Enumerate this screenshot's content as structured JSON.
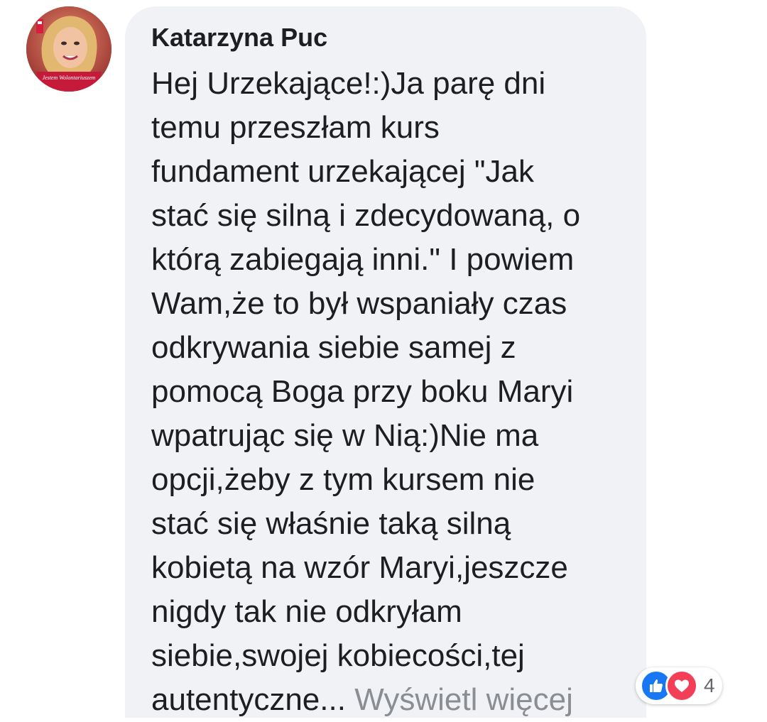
{
  "comment": {
    "author": "Katarzyna Puc",
    "body_lines": [
      "Hej Urzekające!:)Ja parę dni",
      "temu przeszłam kurs",
      "fundament urzekającej \"Jak",
      "stać się silną i zdecydowaną, o",
      "którą zabiegają inni.\" I powiem",
      "Wam,że to był wspaniały czas",
      "odkrywania siebie samej z",
      "pomocą Boga przy boku Maryi",
      "wpatrując się w Nią:)Nie ma",
      "opcji,żeby z tym kursem nie",
      "stać się właśnie taką silną",
      "kobietą na wzór Maryi,jeszcze",
      "nigdy tak nie odkryłam",
      "siebie,swojej kobiecości,tej"
    ],
    "last_line": "autentyczne...",
    "see_more_label": "Wyświetl więcej",
    "avatar_caption": "Jestem Wolontariuszem",
    "reactions": {
      "icons": [
        "like-icon",
        "love-icon"
      ],
      "count": "4",
      "like_color": "#1877f2",
      "love_color": "#f33e58"
    }
  }
}
